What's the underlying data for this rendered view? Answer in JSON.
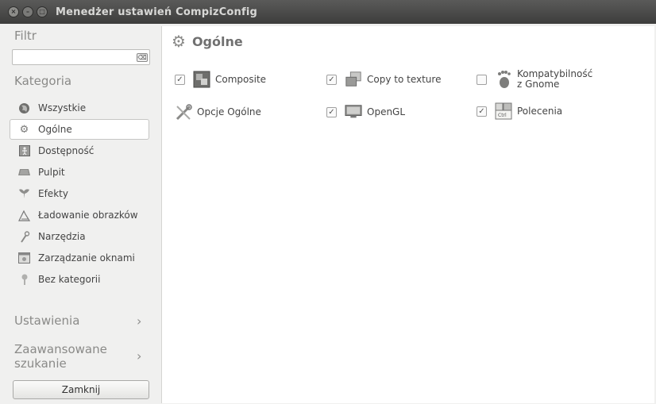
{
  "window": {
    "title": "Menedżer ustawień CompizConfig"
  },
  "sidebar": {
    "filter_label": "Filtr",
    "filter_value": "",
    "category_label": "Kategoria",
    "items": [
      {
        "label": "Wszystkie",
        "icon": "globe-icon"
      },
      {
        "label": "Ogólne",
        "icon": "gear-icon",
        "active": true
      },
      {
        "label": "Dostępność",
        "icon": "accessibility-icon"
      },
      {
        "label": "Pulpit",
        "icon": "desktop-icon"
      },
      {
        "label": "Efekty",
        "icon": "effects-icon"
      },
      {
        "label": "Ładowanie obrazków",
        "icon": "image-loading-icon"
      },
      {
        "label": "Narzędzia",
        "icon": "tools-icon"
      },
      {
        "label": "Zarządzanie oknami",
        "icon": "window-management-icon"
      },
      {
        "label": "Bez kategorii",
        "icon": "uncategorized-icon"
      }
    ],
    "settings_label": "Ustawienia",
    "advanced_search_label_line1": "Zaawansowane",
    "advanced_search_label_line2": "szukanie",
    "close_label": "Zamknij"
  },
  "main": {
    "title": "Ogólne",
    "plugins": [
      {
        "label": "Composite",
        "checked": true,
        "icon": "composite-icon"
      },
      {
        "label": "Copy to texture",
        "checked": true,
        "icon": "copy-to-texture-icon"
      },
      {
        "label": "Kompatybilność",
        "label2": "z Gnome",
        "checked": false,
        "icon": "gnome-foot-icon"
      },
      {
        "label": "Opcje Ogólne",
        "checked": null,
        "icon": "general-options-icon"
      },
      {
        "label": "OpenGL",
        "checked": true,
        "icon": "opengl-icon"
      },
      {
        "label": "Polecenia",
        "checked": true,
        "icon": "commands-icon"
      }
    ]
  }
}
